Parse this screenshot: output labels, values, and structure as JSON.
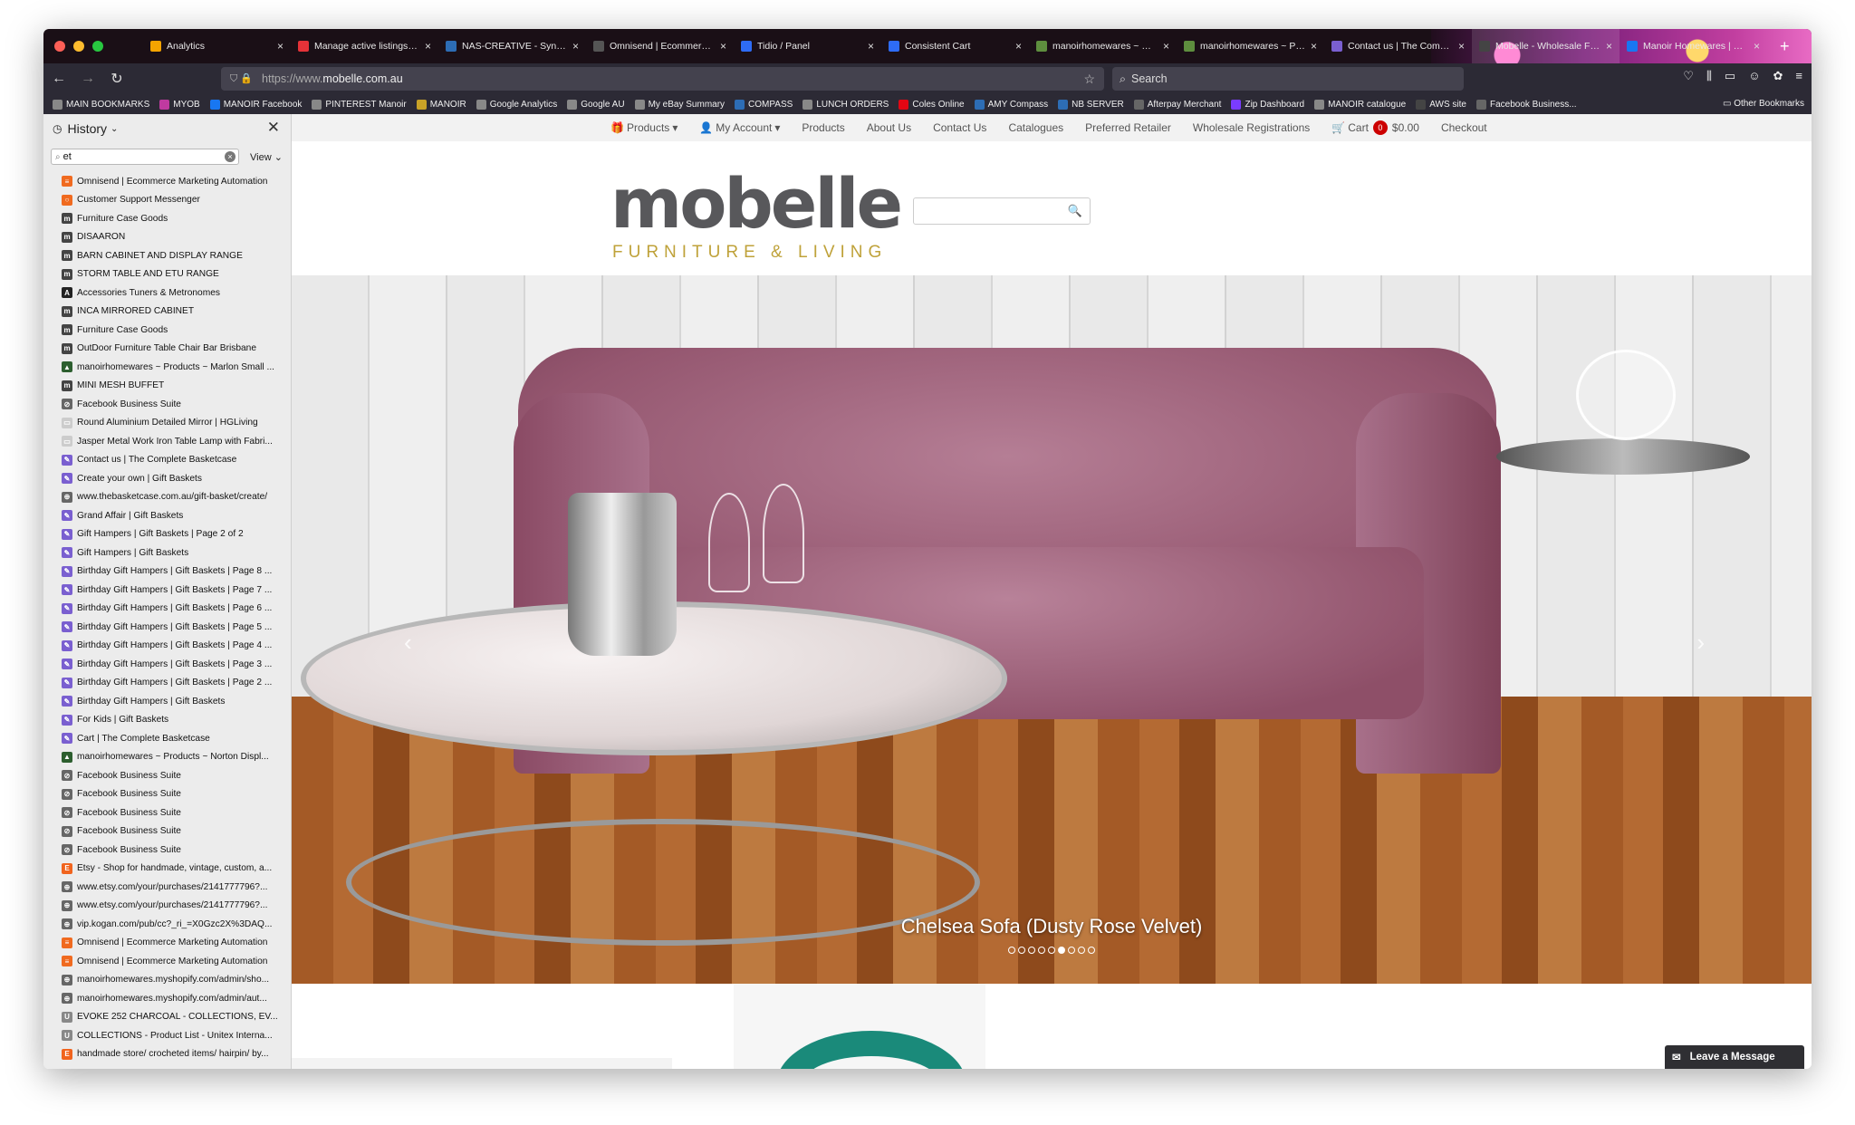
{
  "tabs": [
    {
      "label": "Analytics",
      "color": "#f4a300"
    },
    {
      "label": "Manage active listings - eBay",
      "color": "#e53238"
    },
    {
      "label": "NAS-CREATIVE - Synology",
      "color": "#2d6db5"
    },
    {
      "label": "Omnisend | Ecommerce Marketing",
      "color": "#555555"
    },
    {
      "label": "Tidio / Panel",
      "color": "#2e6cf6"
    },
    {
      "label": "Consistent Cart",
      "color": "#2e6cf6"
    },
    {
      "label": "manoirhomewares ~ Orders",
      "color": "#5e8e3e"
    },
    {
      "label": "manoirhomewares ~ Products",
      "color": "#5e8e3e"
    },
    {
      "label": "Contact us | The Complete Basketcase",
      "color": "#7a5fd0"
    },
    {
      "label": "Mobelle - Wholesale Furniture",
      "color": "#444444"
    },
    {
      "label": "Manoir Homewares | Facebook",
      "color": "#1877f2"
    }
  ],
  "nav": {
    "url_prefix": "https://www.",
    "url_domain": "mobelle.com.au",
    "search_placeholder": "Search"
  },
  "bookmarks": [
    "MAIN BOOKMARKS",
    "MYOB",
    "MANOIR Facebook",
    "PINTEREST Manoir",
    "MANOIR",
    "Google Analytics",
    "Google AU",
    "My eBay Summary",
    "COMPASS",
    "LUNCH ORDERS",
    "Coles Online",
    "AMY Compass",
    "NB SERVER",
    "Afterpay Merchant",
    "Zip Dashboard",
    "MANOIR catalogue",
    "AWS site",
    "Facebook Business..."
  ],
  "bookmarks_other": "Other Bookmarks",
  "sidebar": {
    "title": "History",
    "search_value": "et",
    "view_label": "View",
    "items": [
      {
        "label": "Omnisend | Ecommerce Marketing Automation",
        "c": "#f06a1f",
        "g": "≡"
      },
      {
        "label": "Customer Support Messenger",
        "c": "#f06a1f",
        "g": "○"
      },
      {
        "label": "Furniture Case Goods",
        "c": "#444444",
        "g": "m"
      },
      {
        "label": "DISAARON",
        "c": "#444444",
        "g": "m"
      },
      {
        "label": "BARN CABINET AND DISPLAY RANGE",
        "c": "#444444",
        "g": "m"
      },
      {
        "label": "STORM TABLE AND ETU RANGE",
        "c": "#444444",
        "g": "m"
      },
      {
        "label": "Accessories Tuners & Metronomes",
        "c": "#222222",
        "g": "A"
      },
      {
        "label": "INCA MIRRORED CABINET",
        "c": "#444444",
        "g": "m"
      },
      {
        "label": "Furniture Case Goods",
        "c": "#444444",
        "g": "m"
      },
      {
        "label": "OutDoor Furniture Table Chair Bar Brisbane",
        "c": "#444444",
        "g": "m"
      },
      {
        "label": "manoirhomewares ~ Products ~ Marlon Small ...",
        "c": "#2c5e2e",
        "g": "▲"
      },
      {
        "label": "MINI MESH BUFFET",
        "c": "#444444",
        "g": "m"
      },
      {
        "label": "Facebook Business Suite",
        "c": "#666666",
        "g": "⊘"
      },
      {
        "label": "Round Aluminium Detailed Mirror | HGLiving",
        "c": "#cccccc",
        "g": "▭"
      },
      {
        "label": "Jasper Metal Work Iron Table Lamp with Fabri...",
        "c": "#cccccc",
        "g": "▭"
      },
      {
        "label": "Contact us | The Complete Basketcase",
        "c": "#7a5fd0",
        "g": "✎"
      },
      {
        "label": "Create your own | Gift Baskets",
        "c": "#7a5fd0",
        "g": "✎"
      },
      {
        "label": "www.thebasketcase.com.au/gift-basket/create/",
        "c": "#666666",
        "g": "⊕"
      },
      {
        "label": "Grand Affair | Gift Baskets",
        "c": "#7a5fd0",
        "g": "✎"
      },
      {
        "label": "Gift Hampers | Gift Baskets | Page 2 of 2",
        "c": "#7a5fd0",
        "g": "✎"
      },
      {
        "label": "Gift Hampers | Gift Baskets",
        "c": "#7a5fd0",
        "g": "✎"
      },
      {
        "label": "Birthday Gift Hampers | Gift Baskets | Page 8 ...",
        "c": "#7a5fd0",
        "g": "✎"
      },
      {
        "label": "Birthday Gift Hampers | Gift Baskets | Page 7 ...",
        "c": "#7a5fd0",
        "g": "✎"
      },
      {
        "label": "Birthday Gift Hampers | Gift Baskets | Page 6 ...",
        "c": "#7a5fd0",
        "g": "✎"
      },
      {
        "label": "Birthday Gift Hampers | Gift Baskets | Page 5 ...",
        "c": "#7a5fd0",
        "g": "✎"
      },
      {
        "label": "Birthday Gift Hampers | Gift Baskets | Page 4 ...",
        "c": "#7a5fd0",
        "g": "✎"
      },
      {
        "label": "Birthday Gift Hampers | Gift Baskets | Page 3 ...",
        "c": "#7a5fd0",
        "g": "✎"
      },
      {
        "label": "Birthday Gift Hampers | Gift Baskets | Page 2 ...",
        "c": "#7a5fd0",
        "g": "✎"
      },
      {
        "label": "Birthday Gift Hampers | Gift Baskets",
        "c": "#7a5fd0",
        "g": "✎"
      },
      {
        "label": "For Kids | Gift Baskets",
        "c": "#7a5fd0",
        "g": "✎"
      },
      {
        "label": "Cart | The Complete Basketcase",
        "c": "#7a5fd0",
        "g": "✎"
      },
      {
        "label": "manoirhomewares ~ Products ~ Norton Displ...",
        "c": "#2c5e2e",
        "g": "▲"
      },
      {
        "label": "Facebook Business Suite",
        "c": "#666666",
        "g": "⊘"
      },
      {
        "label": "Facebook Business Suite",
        "c": "#666666",
        "g": "⊘"
      },
      {
        "label": "Facebook Business Suite",
        "c": "#666666",
        "g": "⊘"
      },
      {
        "label": "Facebook Business Suite",
        "c": "#666666",
        "g": "⊘"
      },
      {
        "label": "Facebook Business Suite",
        "c": "#666666",
        "g": "⊘"
      },
      {
        "label": "Etsy - Shop for handmade, vintage, custom, a...",
        "c": "#f1641e",
        "g": "E"
      },
      {
        "label": "www.etsy.com/your/purchases/2141777796?...",
        "c": "#666666",
        "g": "⊕"
      },
      {
        "label": "www.etsy.com/your/purchases/2141777796?...",
        "c": "#666666",
        "g": "⊕"
      },
      {
        "label": "vip.kogan.com/pub/cc?_ri_=X0Gzc2X%3DAQ...",
        "c": "#666666",
        "g": "⊕"
      },
      {
        "label": "Omnisend | Ecommerce Marketing Automation",
        "c": "#f06a1f",
        "g": "≡"
      },
      {
        "label": "Omnisend | Ecommerce Marketing Automation",
        "c": "#f06a1f",
        "g": "≡"
      },
      {
        "label": "manoirhomewares.myshopify.com/admin/sho...",
        "c": "#666666",
        "g": "⊕"
      },
      {
        "label": "manoirhomewares.myshopify.com/admin/aut...",
        "c": "#666666",
        "g": "⊕"
      },
      {
        "label": "EVOKE 252 CHARCOAL - COLLECTIONS, EV...",
        "c": "#888888",
        "g": "U"
      },
      {
        "label": "COLLECTIONS - Product List - Unitex Interna...",
        "c": "#888888",
        "g": "U"
      },
      {
        "label": "handmade store/ crocheted items/ hairpin/ by...",
        "c": "#f1641e",
        "g": "E"
      }
    ]
  },
  "site": {
    "nav": {
      "products_menu": "Products",
      "account_menu": "My Account",
      "products": "Products",
      "about": "About Us",
      "contact": "Contact Us",
      "catalogues": "Catalogues",
      "preferred": "Preferred Retailer",
      "wholesale": "Wholesale Registrations",
      "cart_label": "Cart",
      "cart_count": "0",
      "cart_total": "$0.00",
      "checkout": "Checkout"
    },
    "logo_main": "mobelle",
    "logo_sub": "FURNITURE & LIVING",
    "slider": {
      "caption": "Chelsea Sofa (Dusty Rose Velvet)",
      "total_slides": 9,
      "active_index": 5
    },
    "chat_label": "Leave a Message"
  }
}
